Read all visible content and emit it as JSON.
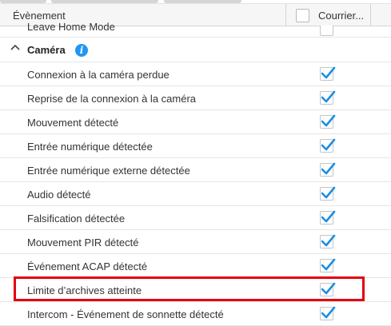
{
  "header": {
    "event_col": "Évènement",
    "mail_col": "Courrier..."
  },
  "partial_row": {
    "label": "Leave Home Mode",
    "checked": false
  },
  "group": {
    "label": "Caméra",
    "info_glyph": "i",
    "expanded": true
  },
  "rows": [
    {
      "label": "Connexion à la caméra perdue",
      "checked": true
    },
    {
      "label": "Reprise de la connexion à la caméra",
      "checked": true
    },
    {
      "label": "Mouvement détecté",
      "checked": true
    },
    {
      "label": "Entrée numérique détectée",
      "checked": true
    },
    {
      "label": "Entrée numérique externe détectée",
      "checked": true
    },
    {
      "label": "Audio détecté",
      "checked": true
    },
    {
      "label": "Falsification détectée",
      "checked": true
    },
    {
      "label": "Mouvement PIR détecté",
      "checked": true
    },
    {
      "label": "Événement ACAP détecté",
      "checked": true
    },
    {
      "label": "Limite d’archives atteinte",
      "checked": true,
      "highlighted": true
    },
    {
      "label": "Intercom - Événement de sonnette détecté",
      "checked": true
    }
  ],
  "colors": {
    "check": "#1a8fe3",
    "highlight": "#e3000f",
    "info": "#2196f3"
  }
}
